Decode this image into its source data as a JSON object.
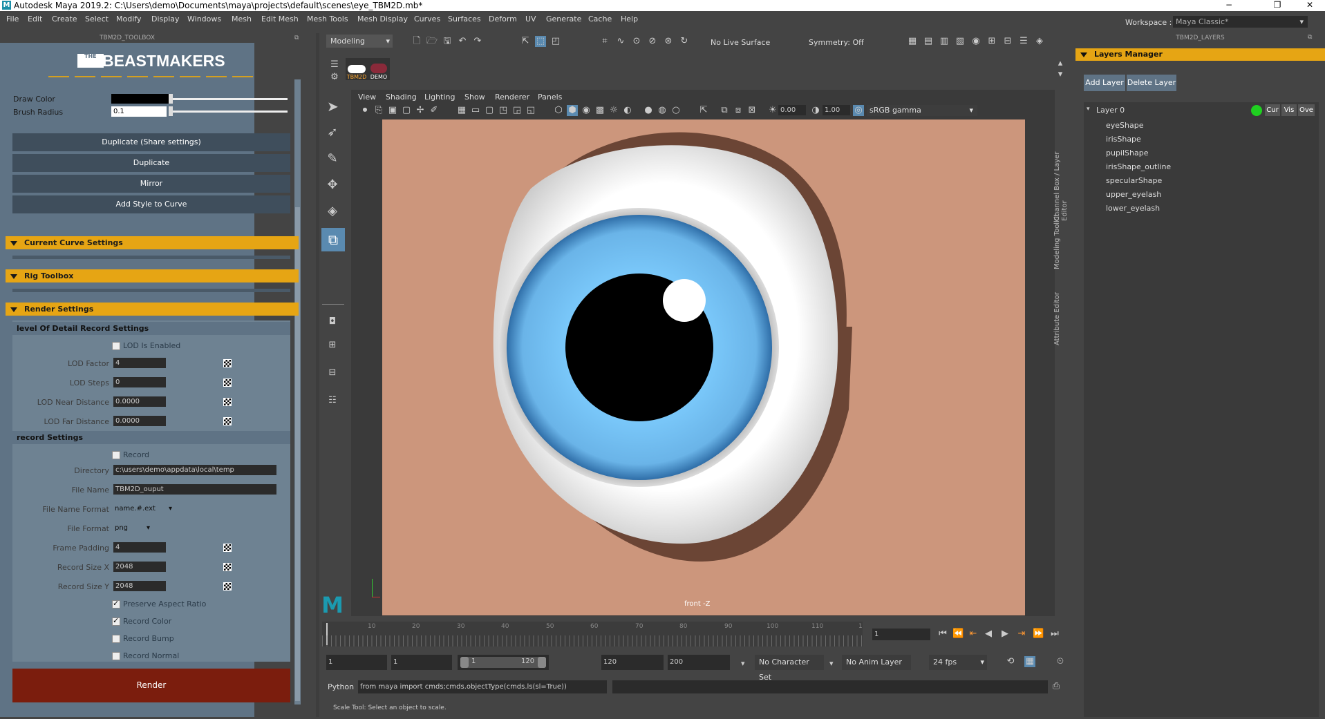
{
  "window": {
    "app_logo": "M",
    "title": "Autodesk Maya 2019.2: C:\\Users\\demo\\Documents\\maya\\projects\\default\\scenes\\eye_TBM2D.mb*",
    "controls": {
      "minimize": "−",
      "restore": "❐",
      "close": "✕"
    }
  },
  "menubar": [
    "File",
    "Edit",
    "Create",
    "Select",
    "Modify",
    "Display",
    "Windows",
    "Mesh",
    "Edit Mesh",
    "Mesh Tools",
    "Mesh Display",
    "Curves",
    "Surfaces",
    "Deform",
    "UV",
    "Generate",
    "Cache",
    "Help"
  ],
  "workspace": {
    "label": "Workspace :",
    "value": "Maya Classic*"
  },
  "status_line": {
    "menu_set": "Modeling",
    "live_surface": "No Live Surface",
    "symmetry": "Symmetry: Off"
  },
  "toolbox": {
    "header": "TBM2D_TOOLBOX",
    "brand_small": "THE",
    "brand": "BEASTMAKERS",
    "draw_color_label": "Draw Color",
    "brush_radius_label": "Brush Radius",
    "brush_radius_value": "0.1",
    "buttons": [
      "Duplicate (Share settings)",
      "Duplicate",
      "Mirror",
      "Add Style to Curve"
    ],
    "sections": [
      "Current Curve Settings",
      "Rig Toolbox",
      "Render Settings"
    ],
    "lod": {
      "title": "level Of Detail Record Settings",
      "enabled_label": "LOD Is Enabled",
      "factor_label": "LOD Factor",
      "factor_value": "4",
      "steps_label": "LOD Steps",
      "steps_value": "0",
      "near_label": "LOD Near Distance",
      "near_value": "0.0000",
      "far_label": "LOD Far Distance",
      "far_value": "0.0000"
    },
    "record": {
      "title": "record Settings",
      "record_label": "Record",
      "directory_label": "Directory",
      "directory_value": "c:\\users\\demo\\appdata\\local\\temp",
      "filename_label": "File Name",
      "filename_value": "TBM2D_ouput",
      "filename_format_label": "File Name Format",
      "filename_format_value": "name.#.ext",
      "file_format_label": "File Format",
      "file_format_value": "png",
      "frame_padding_label": "Frame Padding",
      "frame_padding_value": "4",
      "size_x_label": "Record Size X",
      "size_x_value": "2048",
      "size_y_label": "Record Size Y",
      "size_y_value": "2048",
      "preserve_label": "Preserve Aspect Ratio",
      "record_color_label": "Record Color",
      "record_bump_label": "Record Bump",
      "record_normal_label": "Record Normal"
    },
    "render_button": "Render"
  },
  "viewport": {
    "panel_menus": [
      "View",
      "Shading",
      "Lighting",
      "Show",
      "Renderer",
      "Panels"
    ],
    "exposure": "0.00",
    "gamma": "1.00",
    "color_space": "sRGB gamma",
    "camera_label": "front -Z",
    "shelf_tab_labels": [
      "TBM2D",
      "DEMO"
    ],
    "maya_logo": "M"
  },
  "side_tabs": [
    "Channel Box / Layer Editor",
    "Modeling Toolkit",
    "Attribute Editor"
  ],
  "timeline": {
    "ticks": [
      "10",
      "20",
      "30",
      "40",
      "50",
      "60",
      "70",
      "80",
      "90",
      "100",
      "110",
      "1"
    ],
    "current_frame": "1",
    "range_start": "1",
    "playback_start": "1",
    "range_slider_start": "1",
    "range_slider_end": "120",
    "playback_end": "120",
    "range_end": "200",
    "character_set": "No Character Set",
    "anim_layer": "No Anim Layer",
    "fps": "24 fps"
  },
  "command_line": {
    "language": "Python",
    "command": "from maya import cmds;cmds.objectType(cmds.ls(sl=True))"
  },
  "help_line": "Scale Tool: Select an object to scale.",
  "layers": {
    "header": "TBM2D_LAYERS",
    "manager_title": "Layers Manager",
    "add_button": "Add Layer",
    "delete_button": "Delete Layer",
    "root": "Layer 0",
    "root_buttons": [
      "Cur",
      "Vis",
      "Ove"
    ],
    "items": [
      "eyeShape",
      "irisShape",
      "pupilShape",
      "irisShape_outline",
      "specularShape",
      "upper_eyelash",
      "lower_eyelash"
    ]
  }
}
